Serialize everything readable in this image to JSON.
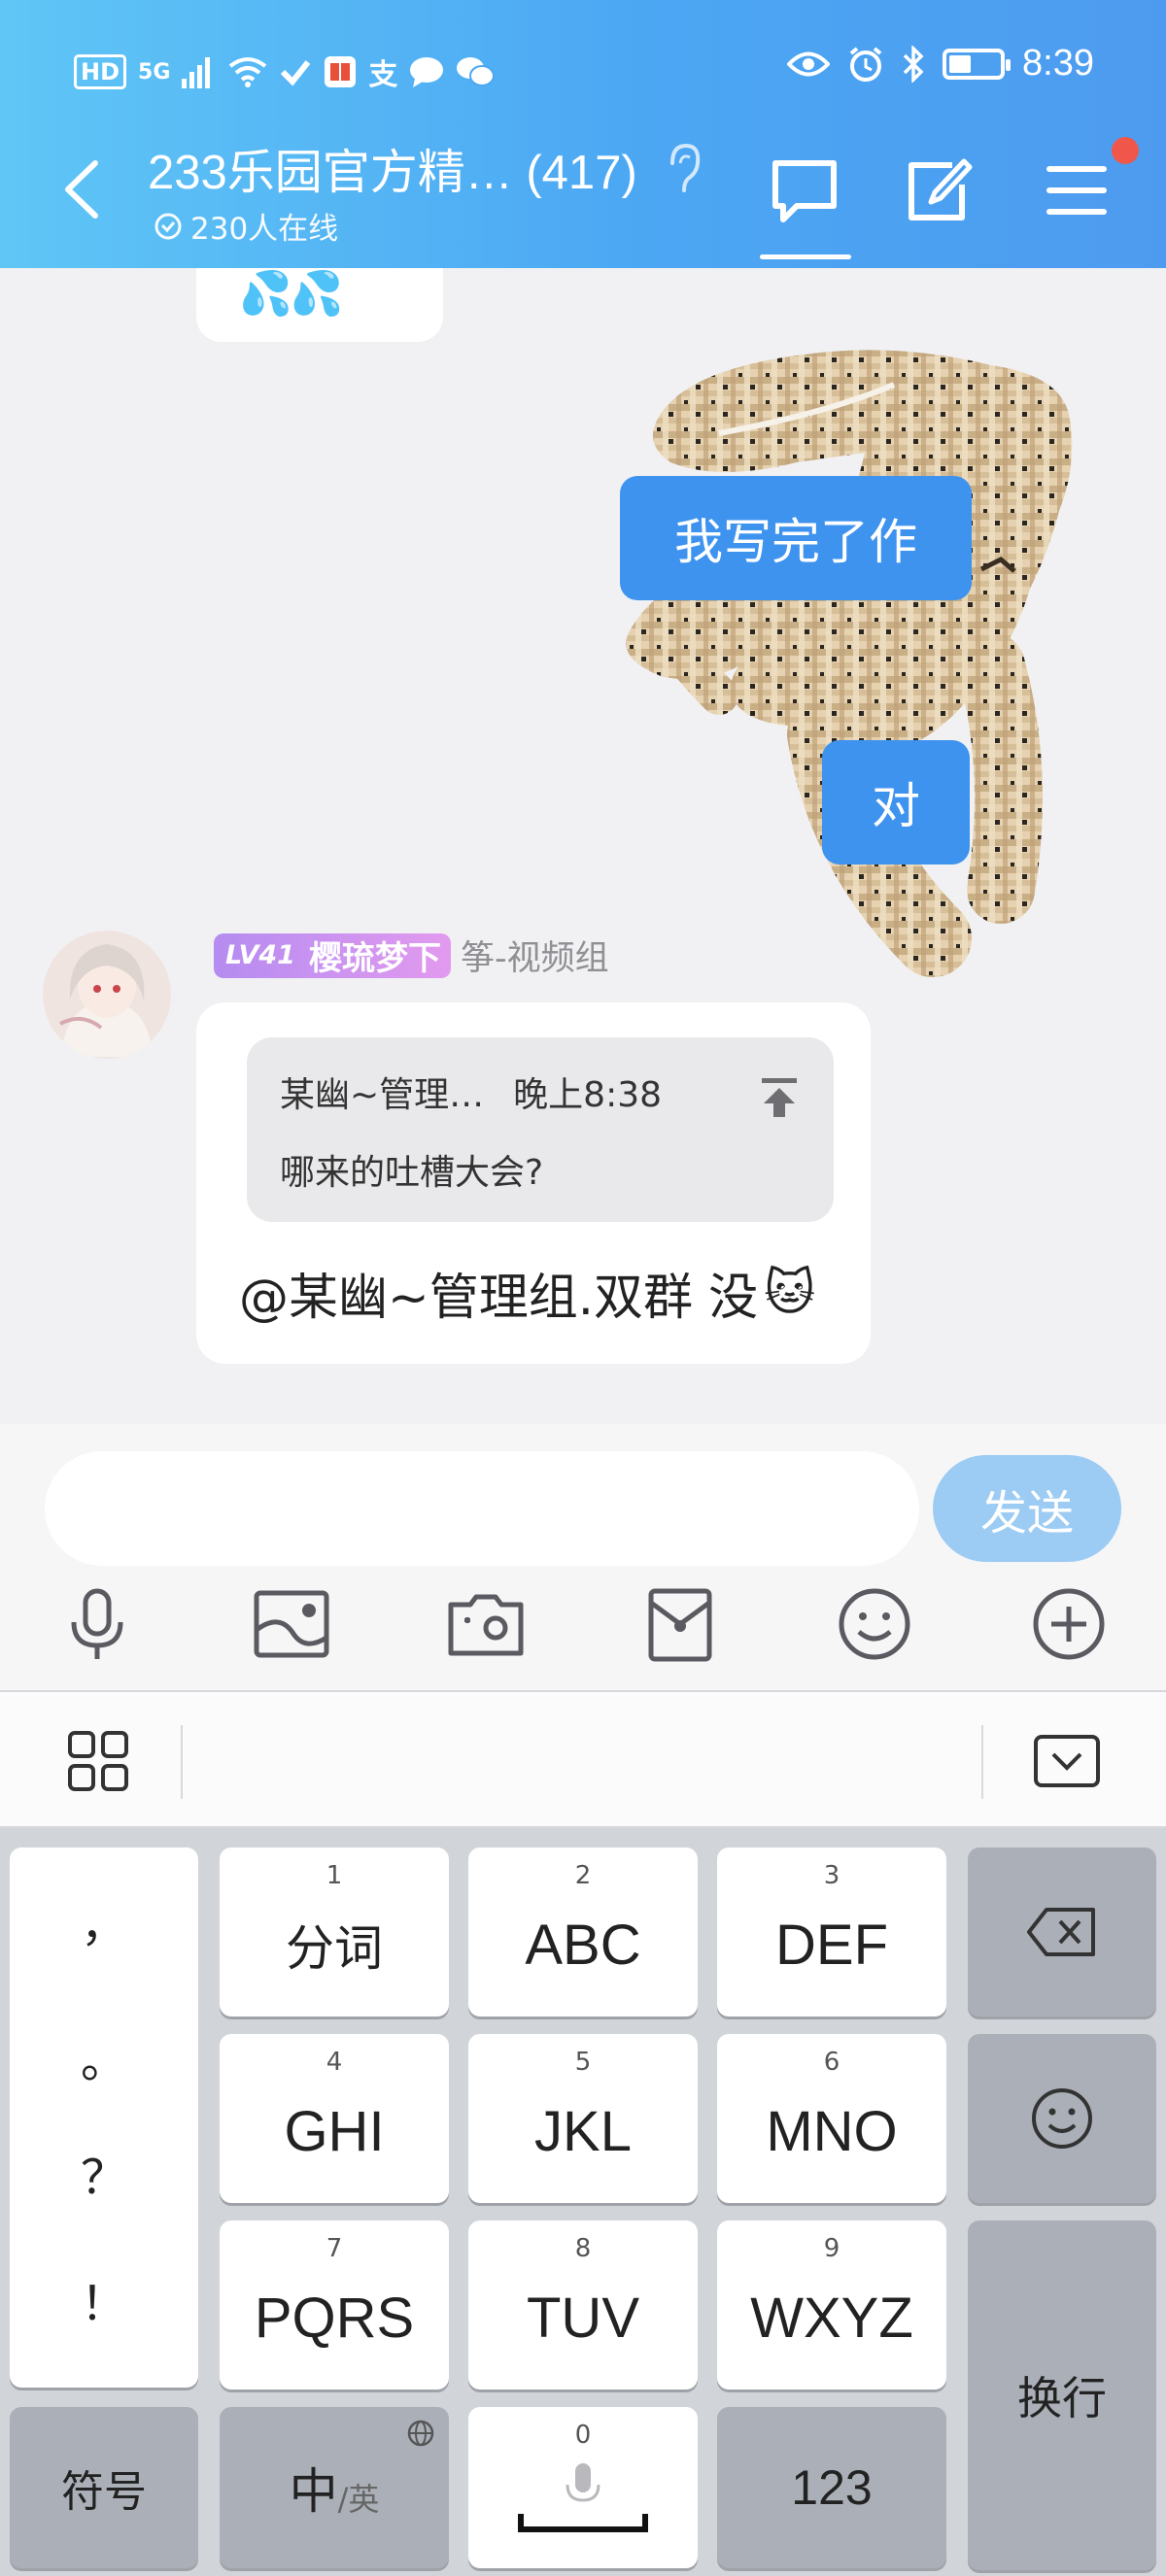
{
  "status_bar": {
    "left_badge": "HD",
    "network": "5G",
    "app_glyph": "支",
    "time": "8:39",
    "battery_level": 0.5
  },
  "header": {
    "group_title": "233乐园官方精… (417)",
    "online_text": "230人在线"
  },
  "messages": {
    "previous_emoji": "💦💦",
    "mine": [
      "我写完了作",
      "对"
    ],
    "other": {
      "level": "LV41",
      "sender_name": "樱琉梦下",
      "sender_tag": "筝-视频组",
      "quote_author": "某幽~管理…",
      "quote_time": "晚上8:38",
      "quote_text": "哪来的吐槽大会?",
      "text": "@某幽~管理组.双群 没",
      "emoji": "🐱"
    }
  },
  "input": {
    "placeholder": "",
    "send_label": "发送"
  },
  "keyboard": {
    "punctuation": [
      "，",
      "。",
      "？",
      "！"
    ],
    "keys": [
      {
        "num": "1",
        "label": "分词"
      },
      {
        "num": "2",
        "label": "ABC"
      },
      {
        "num": "3",
        "label": "DEF"
      },
      {
        "num": "4",
        "label": "GHI"
      },
      {
        "num": "5",
        "label": "JKL"
      },
      {
        "num": "6",
        "label": "MNO"
      },
      {
        "num": "7",
        "label": "PQRS"
      },
      {
        "num": "8",
        "label": "TUV"
      },
      {
        "num": "9",
        "label": "WXYZ"
      }
    ],
    "enter_label": "换行",
    "symbols_label": "符号",
    "lang_main": "中",
    "lang_alt": "/英",
    "space_num": "0",
    "numbers_label": "123"
  },
  "colors": {
    "header_start": "#5fc6f6",
    "header_end": "#4d9bef",
    "my_bubble": "#3e93ef",
    "send_button": "#9ccbf3",
    "notification_dot": "#f0574a"
  }
}
